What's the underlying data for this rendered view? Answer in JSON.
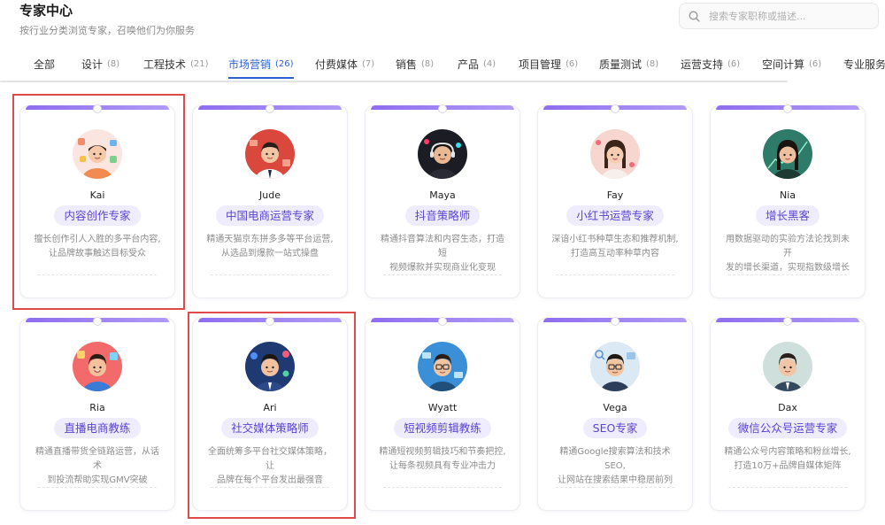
{
  "page": {
    "title": "专家中心",
    "subtitle": "按行业分类浏览专家，召唤他们为你服务"
  },
  "search": {
    "placeholder": "搜索专家职称或描述..."
  },
  "tabs": [
    {
      "label": "全部",
      "count": ""
    },
    {
      "label": "设计",
      "count": "(8)"
    },
    {
      "label": "工程技术",
      "count": "(21)"
    },
    {
      "label": "市场营销",
      "count": "(26)"
    },
    {
      "label": "付费媒体",
      "count": "(7)"
    },
    {
      "label": "销售",
      "count": "(8)"
    },
    {
      "label": "产品",
      "count": "(4)"
    },
    {
      "label": "项目管理",
      "count": "(6)"
    },
    {
      "label": "质量测试",
      "count": "(8)"
    },
    {
      "label": "运营支持",
      "count": "(6)"
    },
    {
      "label": "空间计算",
      "count": "(6)"
    },
    {
      "label": "专业服务",
      "count": ""
    }
  ],
  "active_tab": "市场营销",
  "experts": [
    {
      "name": "Kai",
      "role": "内容创作专家",
      "desc1": "擅长创作引人入胜的多平台内容,",
      "desc2": "让品牌故事触达目标受众"
    },
    {
      "name": "Jude",
      "role": "中国电商运营专家",
      "desc1": "精通天猫京东拼多多等平台运营,",
      "desc2": "从选品到爆款一站式操盘"
    },
    {
      "name": "Maya",
      "role": "抖音策略师",
      "desc1": "精通抖音算法和内容生态，打造短",
      "desc2": "视频爆款并实现商业化变现"
    },
    {
      "name": "Fay",
      "role": "小红书运营专家",
      "desc1": "深谙小红书种草生态和推荐机制,",
      "desc2": "打造高互动率种草内容"
    },
    {
      "name": "Nia",
      "role": "增长黑客",
      "desc1": "用数据驱动的实验方法论找到未开",
      "desc2": "发的增长渠道，实现指数级增长"
    },
    {
      "name": "Ria",
      "role": "直播电商教练",
      "desc1": "精通直播带货全链路运营，从话术",
      "desc2": "到投流帮助实现GMV突破"
    },
    {
      "name": "Ari",
      "role": "社交媒体策略师",
      "desc1": "全面统筹多平台社交媒体策略，让",
      "desc2": "品牌在每个平台发出最强音"
    },
    {
      "name": "Wyatt",
      "role": "短视频剪辑教练",
      "desc1": "精通短视频剪辑技巧和节奏把控,",
      "desc2": "让每条视频具有专业冲击力"
    },
    {
      "name": "Vega",
      "role": "SEO专家",
      "desc1": "精通Google搜索算法和技术SEO,",
      "desc2": "让网站在搜索结果中稳居前列"
    },
    {
      "name": "Dax",
      "role": "微信公众号运营专家",
      "desc1": "精通公众号内容策略和粉丝增长,",
      "desc2": "打造10万+品牌自媒体矩阵"
    }
  ],
  "colors": {
    "accent": "#2f5fd3",
    "role_text": "#5a44d0",
    "role_bg": "#efecfd",
    "card_bar": "#8f6df0",
    "highlight": "#e14a4a"
  }
}
